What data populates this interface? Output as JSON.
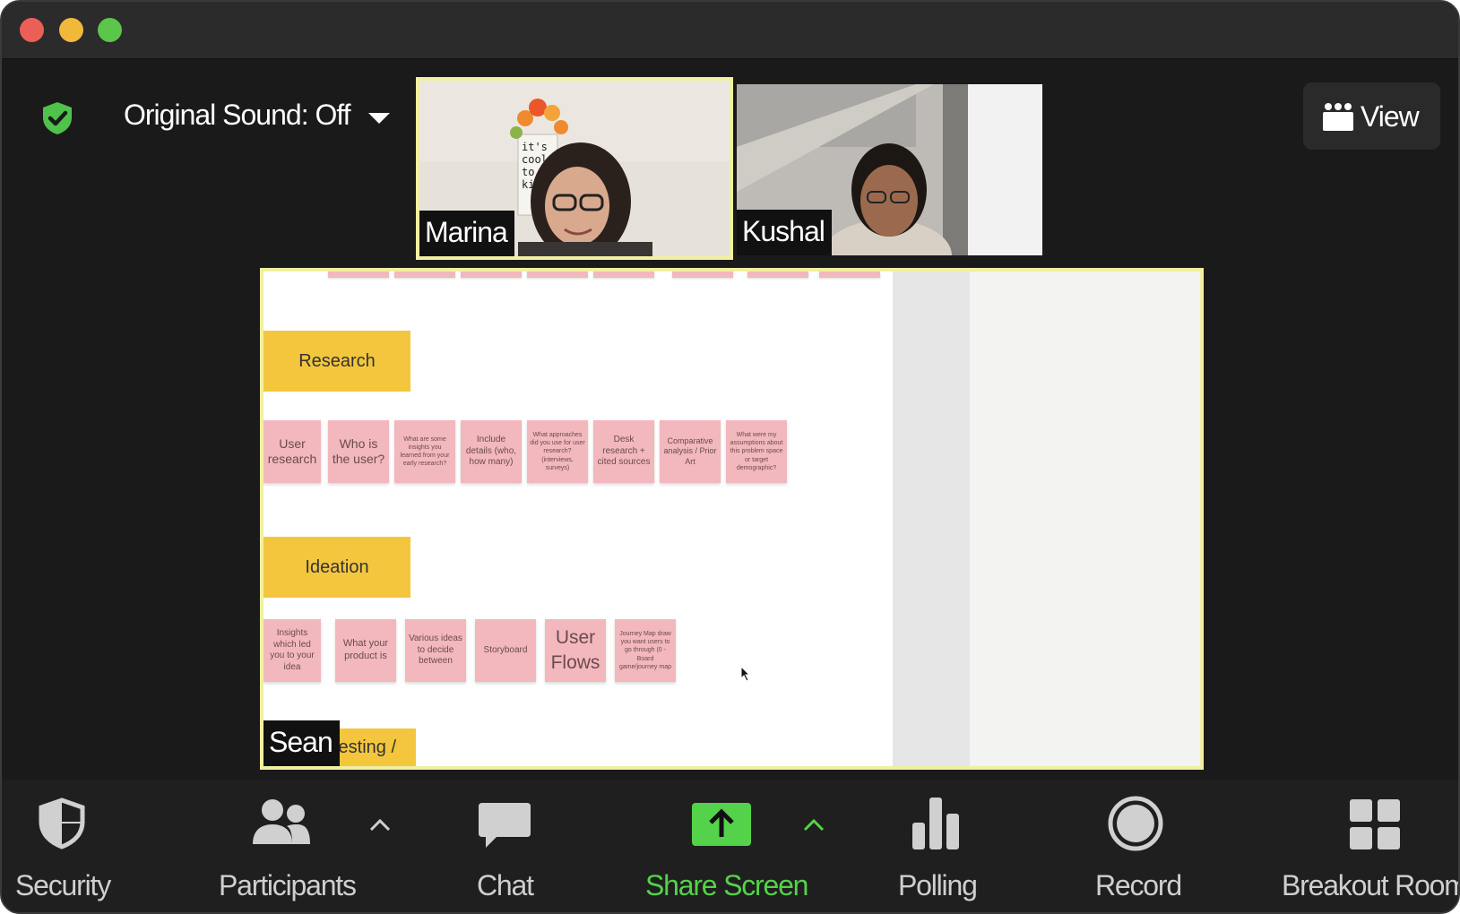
{
  "window": {
    "controls": [
      "close",
      "minimize",
      "maximize"
    ]
  },
  "header": {
    "sound_label": "Original Sound: Off",
    "shield_icon": "shield-check-icon",
    "view_label": "View",
    "view_icon": "gallery-grid-icon"
  },
  "participants": [
    {
      "name": "Marina",
      "active_speaker": true
    },
    {
      "name": "Kushal",
      "active_speaker": false
    }
  ],
  "share": {
    "presenter": "Sean",
    "sections": [
      {
        "label": "Research"
      },
      {
        "label": "Ideation"
      },
      {
        "label": "esting /"
      }
    ],
    "research_notes": [
      "User research",
      "Who is the user?",
      "What are some insights you learned from your early research?",
      "Include details (who, how many)",
      "What approaches did you use for user research? (interviews, surveys)",
      "Desk research + cited sources",
      "Comparative analysis / Prior Art",
      "What were my assumptions about this problem space or target demographic?"
    ],
    "ideation_notes": [
      "Insights which led you to your idea",
      "What your product is",
      "Various ideas to decide between",
      "Storyboard",
      "User Flows",
      "Journey Map draw you want users to go through (0 - Board game/journey map"
    ]
  },
  "toolbar": {
    "security": "Security",
    "participants": "Participants",
    "chat": "Chat",
    "share_screen": "Share Screen",
    "polling": "Polling",
    "record": "Record",
    "breakout": "Breakout Room"
  },
  "colors": {
    "active_border": "#f2efa0",
    "share_green": "#54d24a",
    "section_yellow": "#f4c63d",
    "sticky_pink": "#f2b8bd",
    "toolbar_bg": "#1f1f1f"
  }
}
